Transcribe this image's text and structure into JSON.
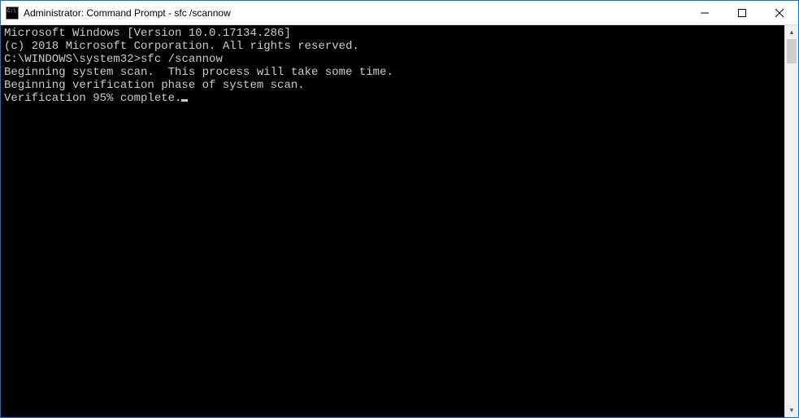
{
  "window": {
    "title": "Administrator: Command Prompt - sfc  /scannow"
  },
  "console": {
    "line1": "Microsoft Windows [Version 10.0.17134.286]",
    "line2": "(c) 2018 Microsoft Corporation. All rights reserved.",
    "blank1": "",
    "prompt_path": "C:\\WINDOWS\\system32>",
    "command": "sfc /scannow",
    "blank2": "",
    "scan_begin": "Beginning system scan.  This process will take some time.",
    "blank3": "",
    "verify_begin": "Beginning verification phase of system scan.",
    "verify_progress": "Verification 95% complete."
  }
}
